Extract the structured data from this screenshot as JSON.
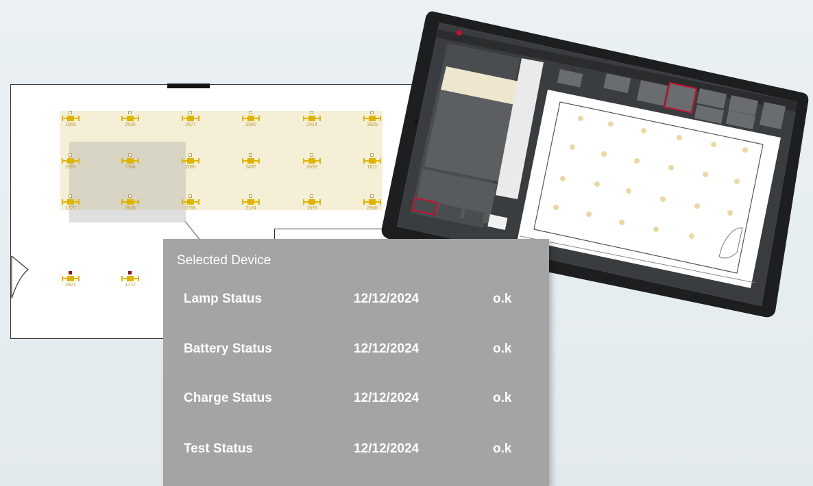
{
  "floor_plan": {
    "fixtures": [
      {
        "id": "1959",
        "row": 0,
        "col": 0,
        "sel": false
      },
      {
        "id": "2535",
        "row": 0,
        "col": 1,
        "sel": false
      },
      {
        "id": "2677",
        "row": 0,
        "col": 2,
        "sel": false
      },
      {
        "id": "2580",
        "row": 0,
        "col": 3,
        "sel": false
      },
      {
        "id": "2414",
        "row": 0,
        "col": 4,
        "sel": false
      },
      {
        "id": "2825",
        "row": 0,
        "col": 5,
        "sel": false
      },
      {
        "id": "2953",
        "row": 1,
        "col": 0,
        "sel": false
      },
      {
        "id": "2384",
        "row": 1,
        "col": 1,
        "sel": false
      },
      {
        "id": "2060",
        "row": 1,
        "col": 2,
        "sel": false
      },
      {
        "id": "2497",
        "row": 1,
        "col": 3,
        "sel": false
      },
      {
        "id": "2635",
        "row": 1,
        "col": 4,
        "sel": false
      },
      {
        "id": "1611",
        "row": 1,
        "col": 5,
        "sel": false
      },
      {
        "id": "1777",
        "row": 2,
        "col": 0,
        "sel": false
      },
      {
        "id": "2928",
        "row": 2,
        "col": 1,
        "sel": false
      },
      {
        "id": "2766",
        "row": 2,
        "col": 2,
        "sel": false
      },
      {
        "id": "2124",
        "row": 2,
        "col": 3,
        "sel": false
      },
      {
        "id": "1576",
        "row": 2,
        "col": 4,
        "sel": false
      },
      {
        "id": "2500",
        "row": 2,
        "col": 5,
        "sel": false
      },
      {
        "id": "2921",
        "row": 3,
        "col": 0,
        "sel": true
      },
      {
        "id": "1772",
        "row": 3,
        "col": 1,
        "sel": true
      }
    ]
  },
  "panel": {
    "title": "Selected Device",
    "rows": [
      {
        "name": "Lamp Status",
        "date": "12/12/2024",
        "state": "o.k"
      },
      {
        "name": "Battery Status",
        "date": "12/12/2024",
        "state": "o.k"
      },
      {
        "name": "Charge Status",
        "date": "12/12/2024",
        "state": "o.k"
      },
      {
        "name": "Test Status",
        "date": "12/12/2024",
        "state": "o.k"
      }
    ]
  },
  "colors": {
    "fixture": "#e0b400",
    "zone": "#f4efd6",
    "panel": "#a4a4a4",
    "accent": "#c8102e"
  }
}
